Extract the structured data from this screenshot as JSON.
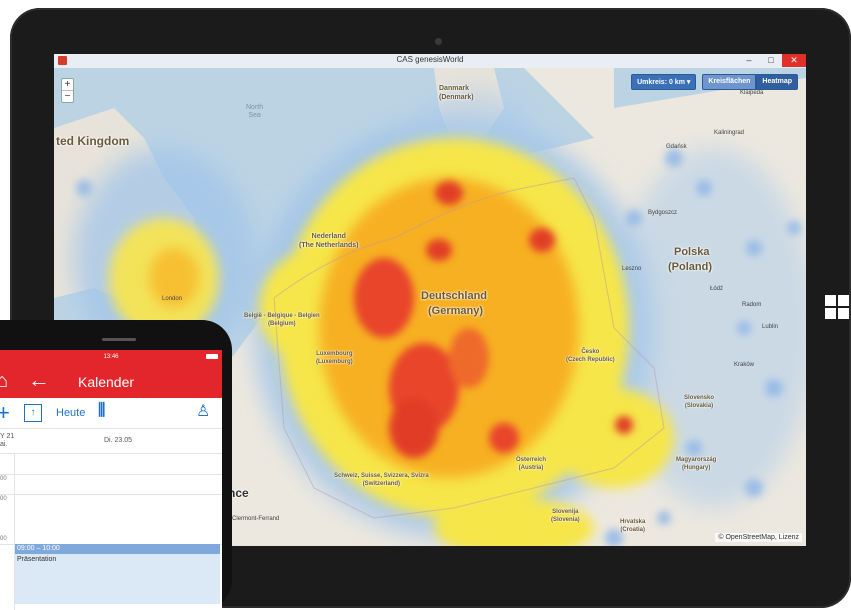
{
  "window": {
    "title": "CAS genesisWorld",
    "minimize": "–",
    "maximize": "□",
    "close": "✕"
  },
  "map": {
    "zoom_in": "+",
    "zoom_out": "−",
    "radius_button": "Umkreis: 0 km ▾",
    "circle_areas_button": "Kreisflächen",
    "heatmap_button": "Heatmap",
    "attribution": "© OpenStreetMap, Lizenz",
    "labels": {
      "north_sea": "North\nSea",
      "united_kingdom": "ted Kingdom",
      "denmark": "Danmark\n(Denmark)",
      "nederland": "Nederland\n(The Netherlands)",
      "belgium": "België - Belgique - Belgien\n(Belgium)",
      "luxembourg": "Luxembourg\n(Luxemburg)",
      "deutschland": "Deutschland",
      "germany": "(Germany)",
      "polska": "Polska",
      "poland": "(Poland)",
      "cesko": "Česko\n(Czech Republic)",
      "slovensko": "Slovensko\n(Slovakia)",
      "osterreich": "Österreich\n(Austria)",
      "switzerland": "Schweiz, Suisse, Svizzera, Svizra\n(Switzerland)",
      "magyarorszag": "Magyarország\n(Hungary)",
      "slovenija": "Slovenija\n(Slovenia)",
      "hrvatska": "Hrvatska\n(Croatia)",
      "france": "nce",
      "london": "London",
      "bydgoszcz": "Bydgoszcz",
      "lodz": "Łódź",
      "krakow": "Kraków",
      "lublin": "Lublin",
      "klaipeda": "Klaipėda",
      "kaliningrad": "Kaliningrad",
      "gdansk": "Gdańsk",
      "leszno": "Leszno",
      "radom": "Radom",
      "clermont": "Clermont-Ferrand"
    }
  },
  "phone": {
    "status_time": "13:46",
    "app_title": "Kalender",
    "toolbar": {
      "today_label": "Heute",
      "calendar_icon_text": "↑"
    },
    "prev_day": "Y 21\nai.",
    "current_day": "Di. 23.05",
    "times": [
      "00",
      "00",
      "00"
    ],
    "event": {
      "time": "09:00 – 10:00",
      "title": "Präsentation"
    }
  }
}
